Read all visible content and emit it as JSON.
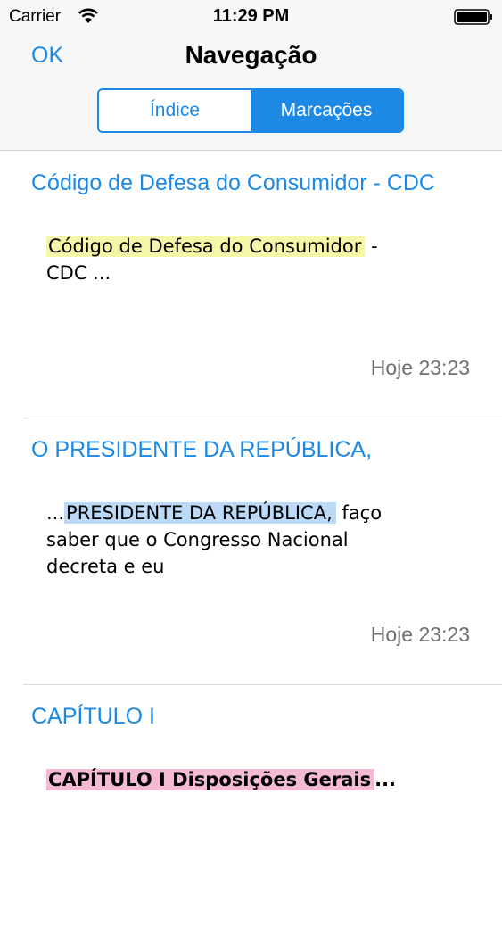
{
  "status_bar": {
    "carrier": "Carrier",
    "time": "11:29 PM"
  },
  "nav": {
    "ok_label": "OK",
    "title": "Navegação",
    "segments": [
      {
        "label": "Índice",
        "selected": false
      },
      {
        "label": "Marcações",
        "selected": true
      }
    ]
  },
  "colors": {
    "accent": "#1d89e4",
    "highlight_yellow": "#f6f6a8",
    "highlight_blue": "#bcd9f5",
    "highlight_pink": "#f3b9d5"
  },
  "bookmarks": [
    {
      "title": "Código de Defesa do Consumidor - CDC",
      "excerpt_prefix": "",
      "excerpt_highlight": "Código de Defesa do Consumidor",
      "excerpt_suffix": " - CDC ...",
      "highlight_color": "yellow",
      "date": "Hoje 23:23"
    },
    {
      "title": "O PRESIDENTE DA REPÚBLICA,",
      "excerpt_prefix": "...",
      "excerpt_highlight": "PRESIDENTE DA REPÚBLICA,",
      "excerpt_suffix": " faço saber que o Congresso Nacional decreta e eu",
      "highlight_color": "blue",
      "date": "Hoje 23:23"
    },
    {
      "title": "CAPÍTULO I",
      "excerpt_prefix": "",
      "excerpt_highlight": "CAPÍTULO I Disposições Gerais",
      "excerpt_suffix": "...",
      "highlight_color": "pink",
      "date": ""
    }
  ]
}
